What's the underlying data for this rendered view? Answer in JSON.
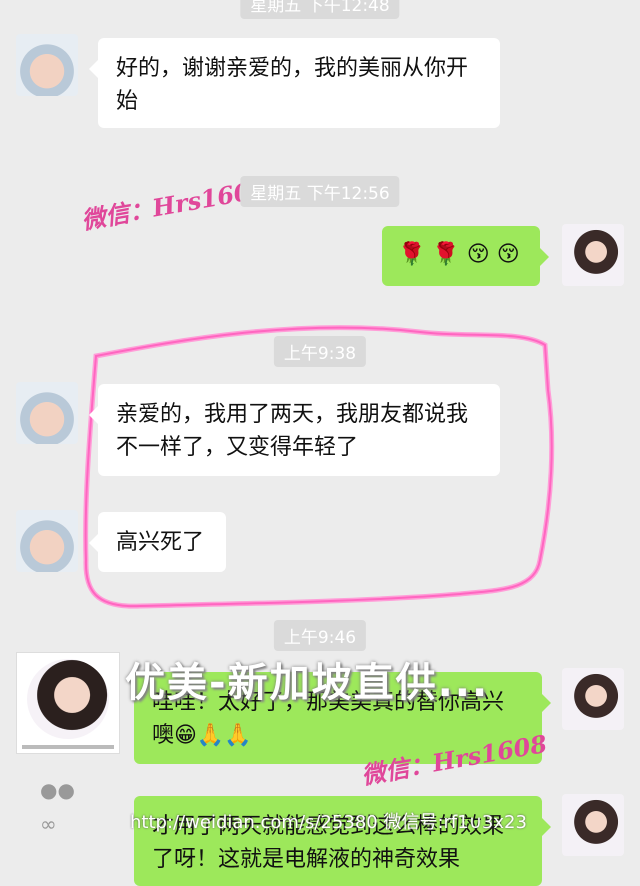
{
  "timestamps": {
    "t0": "星期五 下午12:48",
    "t1": "星期五 下午12:56",
    "t2": "上午9:38",
    "t3": "上午9:46"
  },
  "messages": {
    "m1": "好的，谢谢亲爱的，我的美丽从你开始",
    "m2_emoji": "🌹 🌹 😚 😚",
    "m3": "亲爱的，我用了两天，我朋友都说我不一样了，又变得年轻了",
    "m4": "高兴死了",
    "m5": "哇哇！太好了，那美美真的替你高兴噢😁🙏🙏",
    "m6": "才用了两天就能感觉到这么棒的效果了呀！这就是电解液的神奇效果"
  },
  "watermarks": {
    "wechat1": "微信：Hrs1608",
    "wechat2": "微信：Hrs1608",
    "overlay": "优美-新加坡直供...",
    "url": "http://weidian.com/s/25380 微信号:rf1∪3x23"
  },
  "avatars": {
    "incoming": "baby-avatar",
    "outgoing": "woman-avatar"
  },
  "colors": {
    "out_bubble": "#9de85b",
    "in_bubble": "#ffffff",
    "highlight": "#ff4fb6",
    "watermark": "#e0479a"
  }
}
